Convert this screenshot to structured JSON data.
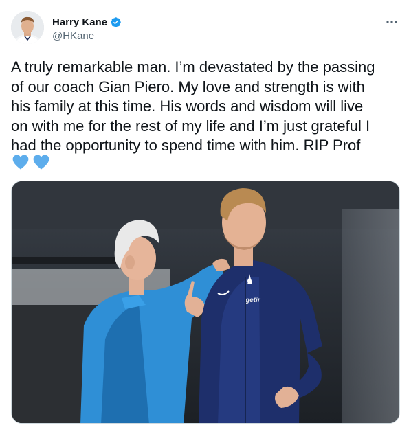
{
  "author": {
    "display_name": "Harry Kane",
    "handle": "@HKane",
    "verified": true
  },
  "tweet": {
    "text_lines": [
      "A truly remarkable man. I’m devastated by the passing",
      "of our coach Gian Piero. My love and strength is with",
      "his family at this time. His words and wisdom will live",
      "on with me for the rest of my life and I’m just grateful I",
      "had the opportunity to spend time with him. RIP Prof"
    ],
    "emojis": [
      "blue-heart",
      "blue-heart"
    ]
  },
  "media": {
    "description_icon": "photo",
    "jersey_sponsor": "getir"
  },
  "colors": {
    "verified_blue": "#1d9bf0",
    "heart_blue": "#5dadec",
    "text": "#0f1419",
    "secondary": "#536471",
    "border": "#cfd9de"
  }
}
